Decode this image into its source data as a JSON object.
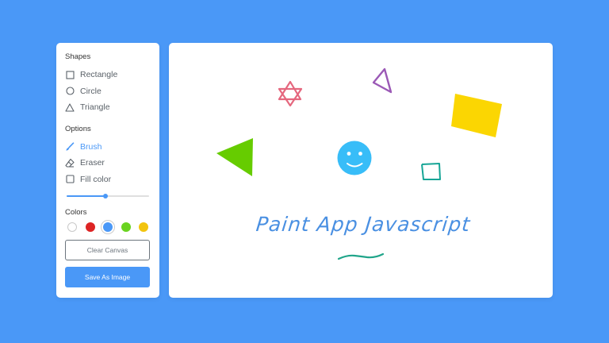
{
  "toolbar": {
    "shapes_title": "Shapes",
    "shapes": [
      {
        "label": "Rectangle",
        "icon": "square-outline-icon"
      },
      {
        "label": "Circle",
        "icon": "circle-outline-icon"
      },
      {
        "label": "Triangle",
        "icon": "triangle-outline-icon"
      }
    ],
    "options_title": "Options",
    "options": [
      {
        "label": "Brush",
        "icon": "brush-icon",
        "active": true
      },
      {
        "label": "Eraser",
        "icon": "eraser-icon",
        "active": false
      },
      {
        "label": "Fill color",
        "icon": "checkbox-icon",
        "active": false
      }
    ],
    "brush_size_fraction": 0.47,
    "colors_title": "Colors",
    "colors": [
      {
        "hex": "#ffffff",
        "selected": false
      },
      {
        "hex": "#dd2424",
        "selected": false
      },
      {
        "hex": "#4a98f7",
        "selected": true
      },
      {
        "hex": "#6ad320",
        "selected": false
      },
      {
        "hex": "#f2c40f",
        "selected": false
      }
    ],
    "clear_label": "Clear Canvas",
    "save_label": "Save As Image"
  },
  "canvas": {
    "drawn_text": "Paint App  Javascript",
    "drawing_colors": {
      "star": "#e5677e",
      "outline_triangle": "#9b59b6",
      "filled_rect": "#fbd602",
      "filled_triangle": "#66cc00",
      "smiley": "#38bdf8",
      "small_square": "#17a596",
      "squiggle": "#20a58a",
      "text": "#4a90e2"
    }
  },
  "theme": {
    "background": "#4a98f7",
    "accent": "#4a98f7"
  }
}
